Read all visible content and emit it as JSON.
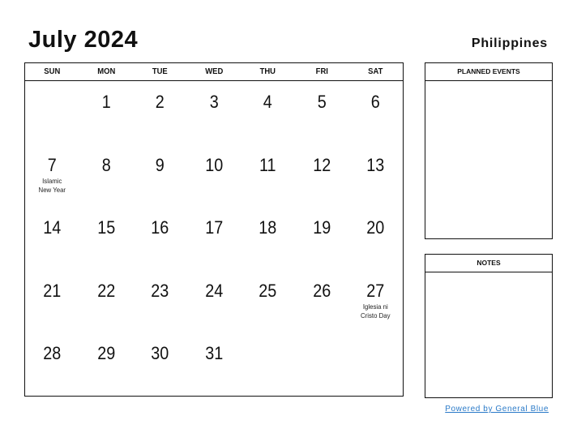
{
  "header": {
    "title": "July 2024",
    "country": "Philippines"
  },
  "calendar": {
    "weekdays": [
      "SUN",
      "MON",
      "TUE",
      "WED",
      "THU",
      "FRI",
      "SAT"
    ],
    "weeks": [
      [
        {
          "d": ""
        },
        {
          "d": "1"
        },
        {
          "d": "2"
        },
        {
          "d": "3"
        },
        {
          "d": "4"
        },
        {
          "d": "5"
        },
        {
          "d": "6"
        }
      ],
      [
        {
          "d": "7",
          "h": "Islamic New Year"
        },
        {
          "d": "8"
        },
        {
          "d": "9"
        },
        {
          "d": "10"
        },
        {
          "d": "11"
        },
        {
          "d": "12"
        },
        {
          "d": "13"
        }
      ],
      [
        {
          "d": "14"
        },
        {
          "d": "15"
        },
        {
          "d": "16"
        },
        {
          "d": "17"
        },
        {
          "d": "18"
        },
        {
          "d": "19"
        },
        {
          "d": "20"
        }
      ],
      [
        {
          "d": "21"
        },
        {
          "d": "22"
        },
        {
          "d": "23"
        },
        {
          "d": "24"
        },
        {
          "d": "25"
        },
        {
          "d": "26"
        },
        {
          "d": "27",
          "h": "Iglesia ni Cristo Day"
        }
      ],
      [
        {
          "d": "28"
        },
        {
          "d": "29"
        },
        {
          "d": "30"
        },
        {
          "d": "31"
        },
        {
          "d": ""
        },
        {
          "d": ""
        },
        {
          "d": ""
        }
      ]
    ]
  },
  "panels": {
    "planned_events": "PLANNED EVENTS",
    "notes": "NOTES"
  },
  "footer": {
    "link": "Powered by General Blue",
    "link_color": "#2a7ac8"
  }
}
